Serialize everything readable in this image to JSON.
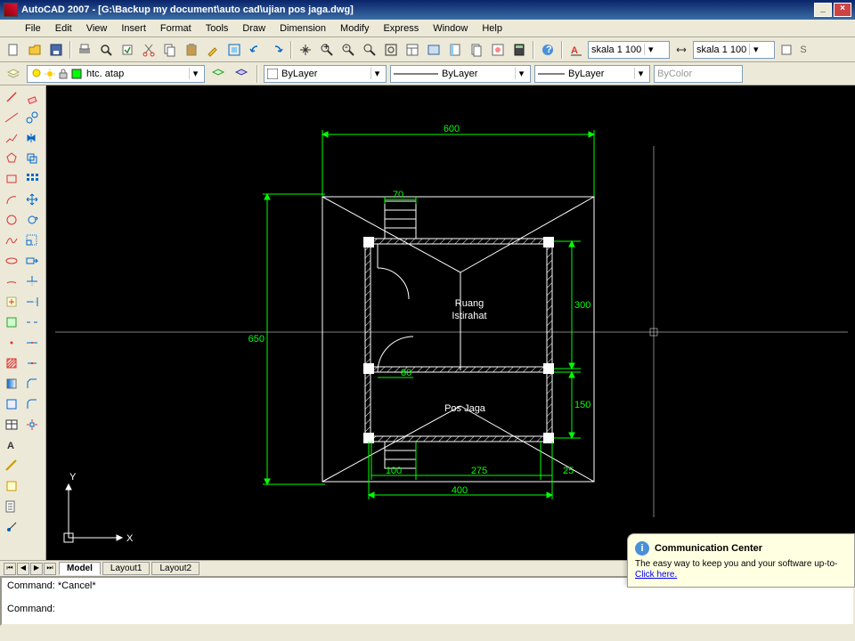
{
  "title": "AutoCAD 2007 - [G:\\Backup my document\\auto cad\\ujian pos jaga.dwg]",
  "menus": [
    "File",
    "Edit",
    "View",
    "Insert",
    "Format",
    "Tools",
    "Draw",
    "Dimension",
    "Modify",
    "Express",
    "Window",
    "Help"
  ],
  "scale_combo1": "skala 1 100",
  "scale_combo2": "skala 1 100",
  "layer_name": "htc. atap",
  "prop_color": "ByLayer",
  "prop_ltype": "ByLayer",
  "prop_lweight": "ByLayer",
  "prop_plot": "ByColor",
  "tabs": {
    "model": "Model",
    "l1": "Layout1",
    "l2": "Layout2"
  },
  "cmd1": "Command: *Cancel*",
  "cmd2": "Command:",
  "comm": {
    "title": "Communication Center",
    "body": "The easy way to keep you and your software up-to-",
    "link": "Click here."
  },
  "ucs": {
    "x": "X",
    "y": "Y"
  },
  "dims": {
    "d600": "600",
    "d70": "70",
    "d650": "650",
    "d300": "300",
    "d80": "80",
    "d150": "150",
    "d100": "100",
    "d275": "275",
    "d25": "25",
    "d400": "400"
  },
  "rooms": {
    "r1a": "Ruang",
    "r1b": "Istirahat",
    "r2": "Pos Jaga"
  }
}
